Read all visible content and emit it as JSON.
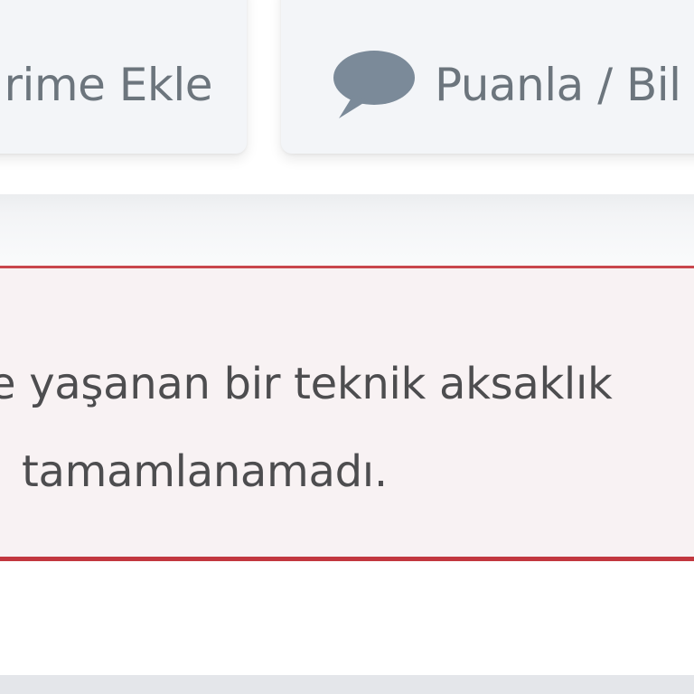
{
  "actions": {
    "add_to_list_label": "rime Ekle",
    "rate_label": "Puanla / Bil",
    "rate_icon": "comment-icon"
  },
  "alert": {
    "line1": "e yaşanan bir teknik aksaklık",
    "line2": "tamamlanamadı."
  },
  "colors": {
    "button_bg": "#f3f5f8",
    "button_text": "#6c757d",
    "icon": "#7b8a99",
    "alert_bg": "#f8f2f3",
    "alert_border": "#c9464d",
    "alert_text": "#4d4d4f"
  }
}
